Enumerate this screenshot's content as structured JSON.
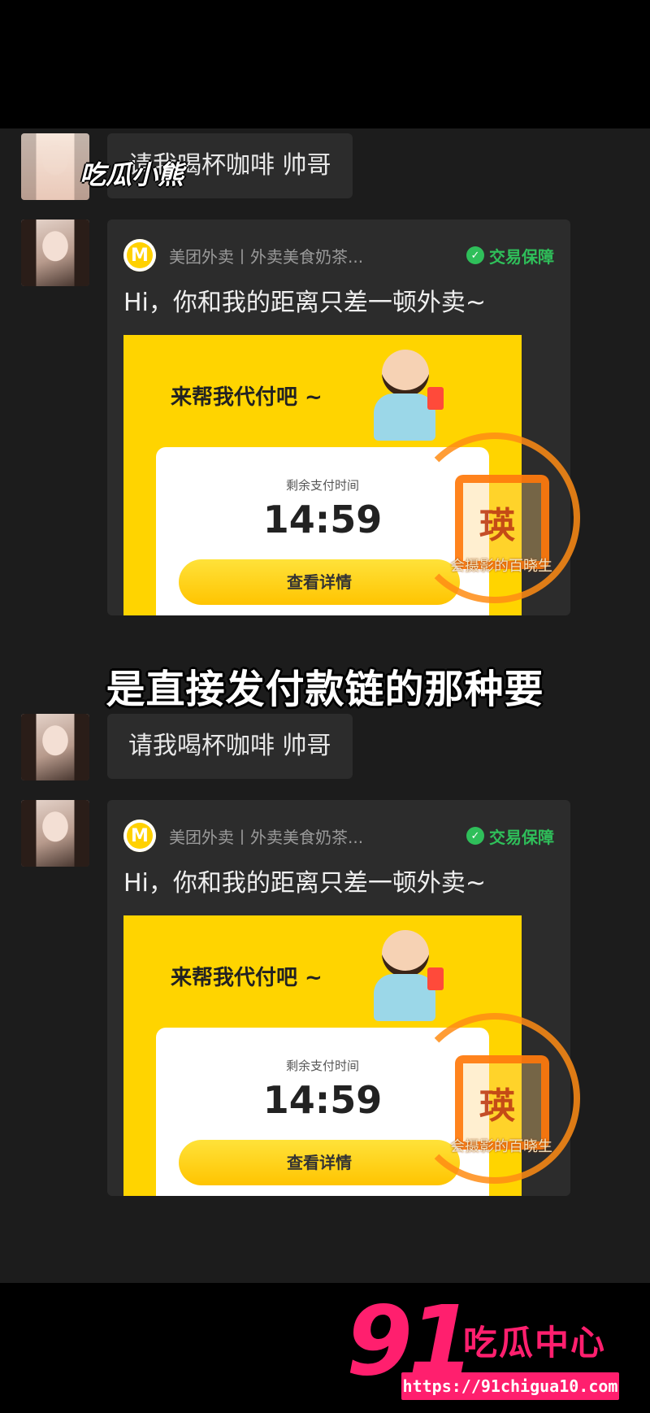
{
  "creator_tag": "吃瓜小熊",
  "caption": "是直接发付款链的那种要",
  "messages": {
    "text1": "请我喝杯咖啡 帅哥",
    "text2": "请我喝杯咖啡 帅哥",
    "card1": {
      "source": "美团外卖丨外卖美食奶茶...",
      "guarantee": "交易保障",
      "message": "Hi，你和我的距离只差一顿外卖~",
      "promo_title": "来帮我代付吧 ~",
      "pay_label": "剩余支付时间",
      "pay_time": "14:59",
      "pay_button": "查看详情"
    },
    "card2": {
      "source": "美团外卖丨外卖美食奶茶...",
      "guarantee": "交易保障",
      "message": "Hi，你和我的距离只差一顿外卖~",
      "promo_title": "来帮我代付吧 ~",
      "pay_label": "剩余支付时间",
      "pay_time": "14:59",
      "pay_button": "查看详情"
    }
  },
  "watermark": {
    "seal_text": "瑛",
    "label": "会摄影的百晓生"
  },
  "site_logo": {
    "number": "91",
    "name": "吃瓜中心",
    "url": "https://91chigua10.com"
  },
  "colors": {
    "accent_yellow": "#ffd400",
    "guarantee_green": "#2fbf5a",
    "logo_pink": "#ff1f6e",
    "watermark_orange": "#ff8c14"
  }
}
